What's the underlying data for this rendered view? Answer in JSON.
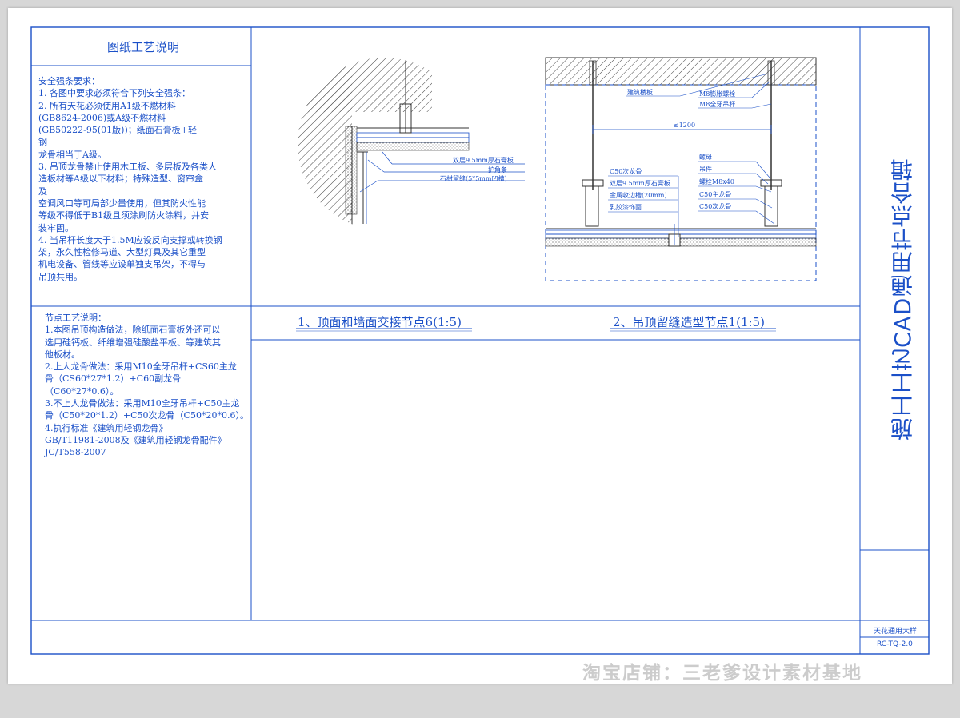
{
  "left_panel": {
    "title": "图纸工艺说明",
    "safety_notes": "安全强条要求：\n1.  各图中要求必须符合下列安全强条：\n2.  所有天花必须使用A1级不燃材料\n    (GB8624-2006)或A级不燃材料\n    (GB50222-95(01版))；纸面石膏板+轻\n    钢\n    龙骨相当于A级。\n3. 吊顶龙骨禁止使用木工板、多层板及各类人\n    造板材等A级以下材料；特殊造型、窗帘盒\n    及\n    空调风口等可局部少量使用，但其防火性能\n    等级不得低于B1级且须涂刷防火涂料，并安\n    装牢固。\n4. 当吊杆长度大于1.5M应设反向支撑或转换钢\n    架，永久性检修马道、大型灯具及其它重型\n    机电设备、管线等应设单独支吊架，不得与\n    吊顶共用。",
    "node_notes": "节点工艺说明：\n1.本图吊顶构造做法，除纸面石膏板外还可以\n选用硅钙板、纤维增强硅酸盐平板、等建筑其\n他板材。\n2.上人龙骨做法：采用M10全牙吊杆+CS60主龙\n骨（CS60*27*1.2）+C60副龙骨（C60*27*0.6）。\n3.不上人龙骨做法：采用M10全牙吊杆+C50主龙\n骨（C50*20*1.2）+C50次龙骨（C50*20*0.6）。\n4.执行标准《建筑用轻钢龙骨》\nGB/T11981-2008及《建筑用轻钢龙骨配件》\nJC/T558-2007"
  },
  "detail1": {
    "caption": "1、顶面和墙面交接节点6(1:5)",
    "labels": [
      "双层9.5mm厚石膏板",
      "护角条",
      "石材留缝(5*5mm凹槽)"
    ]
  },
  "detail2": {
    "caption": "2、吊顶留缝造型节点1(1:5)",
    "labels_top": [
      "建筑楼板",
      "M8膨胀螺栓",
      "M8全牙吊杆"
    ],
    "dimension": "≤1200",
    "labels_left": [
      "C50次龙骨",
      "双层9.5mm厚石膏板",
      "金属收边槽(20mm)",
      "乳胶漆饰面"
    ],
    "labels_right": [
      "螺母",
      "吊件",
      "螺栓M8x40",
      "C50主龙骨",
      "C50次龙骨"
    ]
  },
  "title_block": {
    "title": "施工工艺CAD通用节点合辑",
    "drawing_name": "天花通用大样",
    "drawing_code": "RC-TQ-2.0"
  },
  "watermark": "淘宝店铺：三老爹设计素材基地",
  "colors": {
    "line": "#1b50c8",
    "paper": "#ffffff",
    "background": "#d7d7d7"
  }
}
